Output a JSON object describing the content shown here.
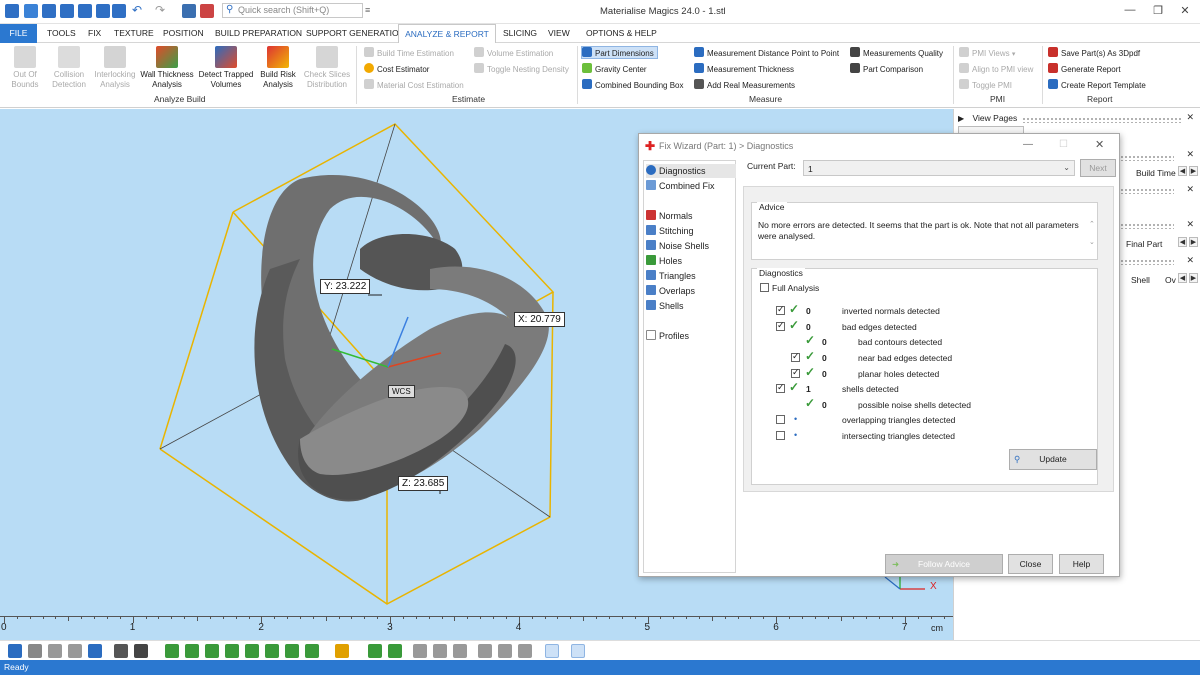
{
  "title_bar": {
    "search_placeholder": "Quick search (Shift+Q)",
    "app_title": "Materialise Magics 24.0 - 1.stl",
    "minimize": "—",
    "restore": "❐",
    "close": "✕"
  },
  "tabs": [
    "FILE",
    "TOOLS",
    "FIX",
    "TEXTURE",
    "POSITION",
    "BUILD PREPARATION",
    "SUPPORT GENERATION",
    "ANALYZE & REPORT",
    "SLICING",
    "VIEW",
    "OPTIONS & HELP"
  ],
  "ribbon": {
    "analyze_build": {
      "label": "Analyze Build",
      "buttons": [
        "Out Of\nBounds",
        "Collision\nDetection",
        "Interlocking\nAnalysis",
        "Wall Thickness\nAnalysis",
        "Detect Trapped\nVolumes",
        "Build Risk\nAnalysis",
        "Check Slices\nDistribution"
      ]
    },
    "estimate": {
      "label": "Estimate",
      "items": [
        "Build Time Estimation",
        "Cost Estimator",
        "Material Cost Estimation",
        "Volume Estimation",
        "Toggle Nesting Density"
      ]
    },
    "measure": {
      "label": "Measure",
      "items": [
        "Part Dimensions",
        "Gravity Center",
        "Combined Bounding Box",
        "Measurement Distance Point to Point",
        "Measurement Thickness",
        "Add Real Measurements",
        "Measurements Quality",
        "Part Comparison"
      ]
    },
    "pmi": {
      "label": "PMI",
      "items": [
        "PMI Views",
        "Align to PMI view",
        "Toggle PMI"
      ]
    },
    "report": {
      "label": "Report",
      "items": [
        "Save Part(s) As 3Dpdf",
        "Generate Report",
        "Create Report Template"
      ]
    }
  },
  "viewport": {
    "dim_y": "Y: 23.222",
    "dim_x": "X: 20.779",
    "dim_z": "Z: 23.685",
    "wcs": "WCS",
    "ruler_ticks": [
      "0",
      "1",
      "2",
      "3",
      "4",
      "5",
      "6",
      "7"
    ],
    "ruler_unit": "cm",
    "axis_x": "X"
  },
  "right_panel": {
    "view_pages": "View Pages",
    "build_time": "Build Time",
    "final_part": "Final Part",
    "shell": "Shell",
    "ov": "Ov"
  },
  "dialog": {
    "title": "Fix Wizard (Part: 1) > Diagnostics",
    "nav": [
      "Diagnostics",
      "Combined Fix",
      "Normals",
      "Stitching",
      "Noise Shells",
      "Holes",
      "Triangles",
      "Overlaps",
      "Shells",
      "Profiles"
    ],
    "current_part_label": "Current Part:",
    "current_part_value": "1",
    "next_button": "Next",
    "advice_label": "Advice",
    "advice_text": "No more errors are detected. It seems that the part is ok. Note that not all parameters were analysed.",
    "diagnostics_label": "Diagnostics",
    "full_analysis": "Full Analysis",
    "rows": [
      {
        "count": "0",
        "label": "inverted normals detected"
      },
      {
        "count": "0",
        "label": "bad edges detected"
      },
      {
        "count": "0",
        "label": "bad contours detected"
      },
      {
        "count": "0",
        "label": "near bad edges detected"
      },
      {
        "count": "0",
        "label": "planar holes detected"
      },
      {
        "count": "1",
        "label": "shells detected"
      },
      {
        "count": "0",
        "label": "possible noise shells detected"
      },
      {
        "count": "",
        "label": "overlapping triangles detected"
      },
      {
        "count": "",
        "label": "intersecting triangles detected"
      }
    ],
    "update_button": "Update",
    "follow_advice_button": "Follow Advice",
    "close_button": "Close",
    "help_button": "Help"
  },
  "status": "Ready"
}
